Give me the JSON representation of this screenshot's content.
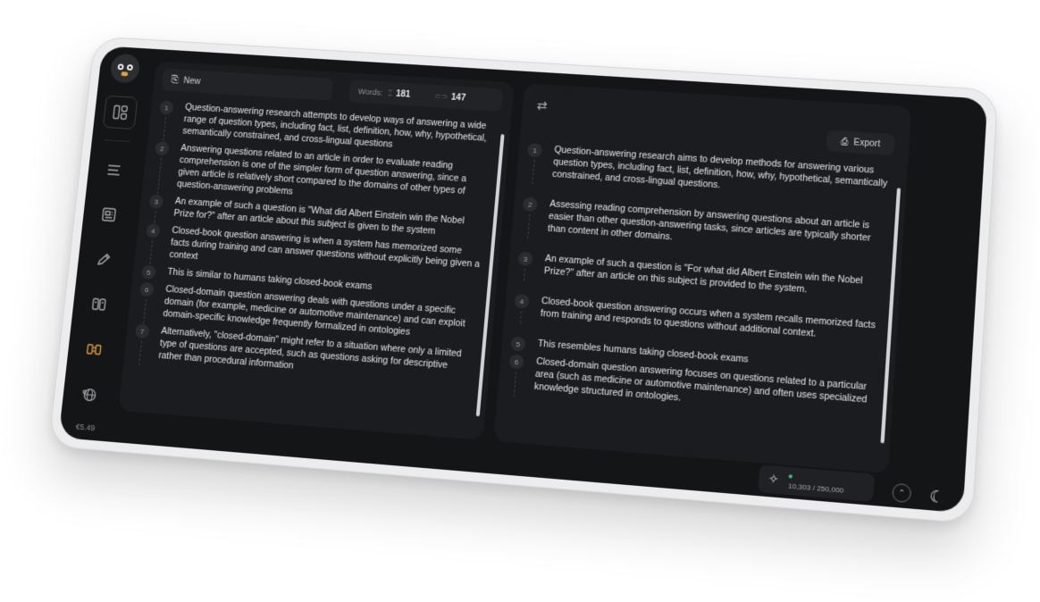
{
  "sidebar": {
    "version": "€5.49",
    "icons": [
      "dashboard-icon",
      "menu-icon",
      "document-icon",
      "pen-icon",
      "compare-icon",
      "translate-icon",
      "globe-icon"
    ]
  },
  "left": {
    "new_label": "New",
    "words_label": "Words:",
    "words_count": "181",
    "sentences_count": "147",
    "items": [
      {
        "n": "1",
        "text": "Question-answering research attempts to develop ways of answering a wide range of question types, including fact, list, definition, how, why, hypothetical, semantically constrained, and cross-lingual questions"
      },
      {
        "n": "2",
        "text": "Answering questions related to an article in order to evaluate reading comprehension is one of the simpler form of question answering, since a given article is relatively short compared to the domains of other types of question-answering problems"
      },
      {
        "n": "3",
        "text": "An example of such a question is \"What did Albert Einstein win the Nobel Prize for?\" after an article about this subject is given to the system"
      },
      {
        "n": "4",
        "text": "Closed-book question answering is when a system has memorized some facts during training and can answer questions without explicitly being given a context"
      },
      {
        "n": "5",
        "text": "This is similar to humans taking closed-book exams"
      },
      {
        "n": "6",
        "text": "Closed-domain question answering deals with questions under a specific domain (for example, medicine or automotive maintenance) and can exploit domain-specific knowledge frequently formalized in ontologies"
      },
      {
        "n": "7",
        "text": "Alternatively, \"closed-domain\" might refer to a situation where only a limited type of questions are accepted, such as questions asking for descriptive rather than procedural information"
      }
    ]
  },
  "right": {
    "export_label": "Export",
    "items": [
      {
        "n": "1",
        "text": "Question-answering research aims to develop methods for answering various question types, including fact, list, definition, how, why, hypothetical, semantically constrained, and cross-lingual questions."
      },
      {
        "n": "2",
        "text": "Assessing reading comprehension by answering questions about an article is easier than other question-answering tasks, since articles are typically shorter than content in other domains."
      },
      {
        "n": "3",
        "text": "An example of such a question is \"For what did Albert Einstein win the Nobel Prize?\" after an article on this subject is provided to the system."
      },
      {
        "n": "4",
        "text": "Closed-book question answering occurs when a system recalls memorized facts from training and responds to questions without additional context."
      },
      {
        "n": "5",
        "text": "This resembles humans taking closed-book exams"
      },
      {
        "n": "6",
        "text": "Closed-domain question answering focuses on questions related to a particular area (such as medicine or automotive maintenance) and often uses specialized knowledge structured in ontologies."
      }
    ]
  },
  "footer": {
    "quota": "10,303 / 250,000"
  },
  "colors": {
    "background": "#141517",
    "panel": "#1b1c1f",
    "accent": "#e0a33a",
    "status": "#3ec27a"
  }
}
